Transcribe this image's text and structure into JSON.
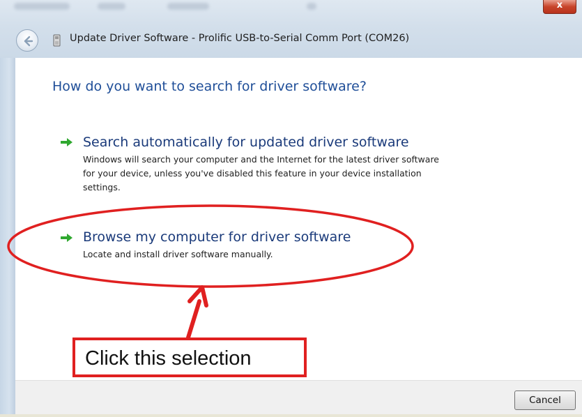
{
  "window": {
    "title": "Update Driver Software - Prolific USB-to-Serial Comm Port (COM26)",
    "close_label": "x"
  },
  "content": {
    "heading": "How do you want to search for driver software?",
    "options": [
      {
        "title": "Search automatically for updated driver software",
        "description_lines": [
          "Windows will search your computer and the Internet for the latest driver software",
          "for your device, unless you've disabled this feature in your device installation",
          "settings."
        ]
      },
      {
        "title": "Browse my computer for driver software",
        "description_lines": [
          "Locate and install driver software manually."
        ]
      }
    ]
  },
  "annotation": {
    "callout_text": "Click this selection",
    "color": "#e02020"
  },
  "footer": {
    "cancel_label": "Cancel"
  },
  "colors": {
    "heading": "#1f4e98",
    "option_title": "#1a3a7a",
    "arrow": "#2fa82f"
  }
}
